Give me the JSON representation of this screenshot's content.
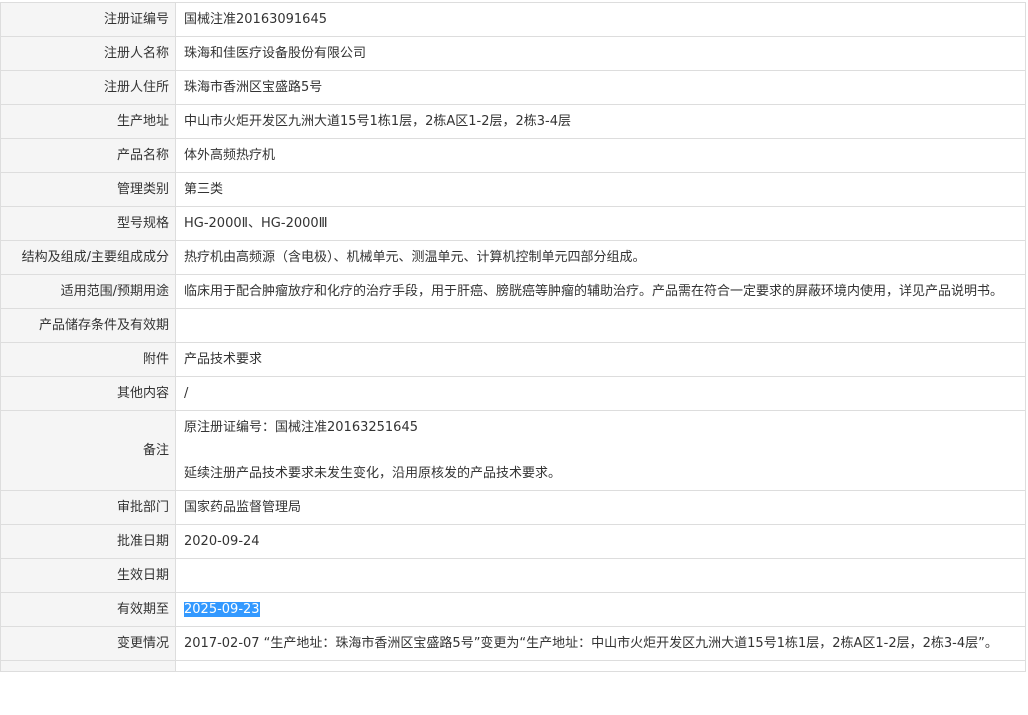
{
  "rows": [
    {
      "label": "注册证编号",
      "value": "国械注准20163091645"
    },
    {
      "label": "注册人名称",
      "value": "珠海和佳医疗设备股份有限公司"
    },
    {
      "label": "注册人住所",
      "value": "珠海市香洲区宝盛路5号"
    },
    {
      "label": "生产地址",
      "value": "中山市火炬开发区九洲大道15号1栋1层，2栋A区1-2层，2栋3-4层"
    },
    {
      "label": "产品名称",
      "value": "体外高频热疗机"
    },
    {
      "label": "管理类别",
      "value": "第三类"
    },
    {
      "label": "型号规格",
      "value": "HG-2000Ⅱ、HG-2000Ⅲ"
    },
    {
      "label": "结构及组成/主要组成成分",
      "value": "热疗机由高频源（含电极）、机械单元、测温单元、计算机控制单元四部分组成。"
    },
    {
      "label": "适用范围/预期用途",
      "value": "临床用于配合肿瘤放疗和化疗的治疗手段，用于肝癌、膀胱癌等肿瘤的辅助治疗。产品需在符合一定要求的屏蔽环境内使用，详见产品说明书。"
    },
    {
      "label": "产品储存条件及有效期",
      "value": ""
    },
    {
      "label": "附件",
      "value": "产品技术要求"
    },
    {
      "label": "其他内容",
      "value": "/"
    },
    {
      "label": "备注",
      "value_line1": "原注册证编号：国械注准20163251645",
      "value_line2": "延续注册产品技术要求未发生变化，沿用原核发的产品技术要求。"
    },
    {
      "label": "审批部门",
      "value": "国家药品监督管理局"
    },
    {
      "label": "批准日期",
      "value": "2020-09-24"
    },
    {
      "label": "生效日期",
      "value": ""
    },
    {
      "label": "有效期至",
      "value": "2025-09-23"
    },
    {
      "label": "变更情况",
      "value": "2017-02-07 “生产地址：珠海市香洲区宝盛路5号”变更为“生产地址：中山市火炬开发区九洲大道15号1栋1层，2栋A区1-2层，2栋3-4层”。"
    },
    {
      "label": "",
      "value": ""
    }
  ],
  "colors": {
    "label_background": "#f5f5f5",
    "border": "#dddddd",
    "text": "#333333",
    "selection_highlight": "#3399ff"
  }
}
